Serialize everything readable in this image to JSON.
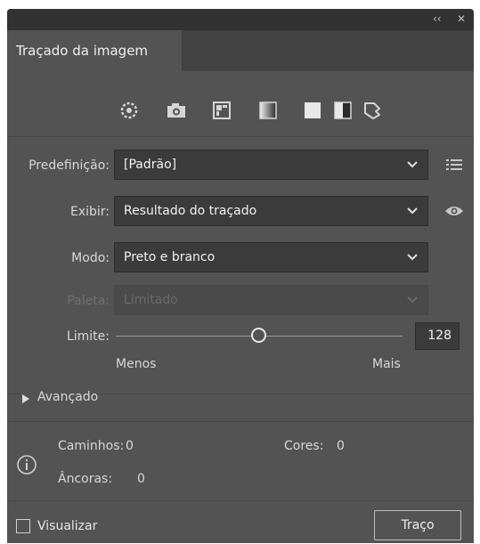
{
  "window": {
    "collapse_glyph": "‹‹",
    "close_glyph": "✕"
  },
  "tab": {
    "label": "Traçado da imagem"
  },
  "presets": {
    "icons": [
      "auto-color-icon",
      "camera-photo-icon",
      "low-color-icon",
      "grayscale-icon",
      "black-white-icon",
      "outline-icon"
    ]
  },
  "fields": {
    "preset_label": "Predefinição:",
    "preset_value": "[Padrão]",
    "view_label": "Exibir:",
    "view_value": "Resultado do traçado",
    "mode_label": "Modo:",
    "mode_value": "Preto e branco",
    "palette_label": "Paleta:",
    "palette_value": "Limitado"
  },
  "threshold": {
    "label": "Limite:",
    "value": "128",
    "min_label": "Menos",
    "max_label": "Mais",
    "level": 0.5
  },
  "advanced": {
    "label": "Avançado"
  },
  "stats": {
    "paths_label": "Caminhos:",
    "paths_value": "0",
    "colors_label": "Cores:",
    "colors_value": "0",
    "anchors_label": "Âncoras:",
    "anchors_value": "0"
  },
  "footer": {
    "preview_label": "Visualizar",
    "trace_label": "Traço"
  },
  "colors": {
    "panel_bg": "#535353",
    "title_bar": "#323232",
    "field_bg": "#3b3b3b"
  }
}
